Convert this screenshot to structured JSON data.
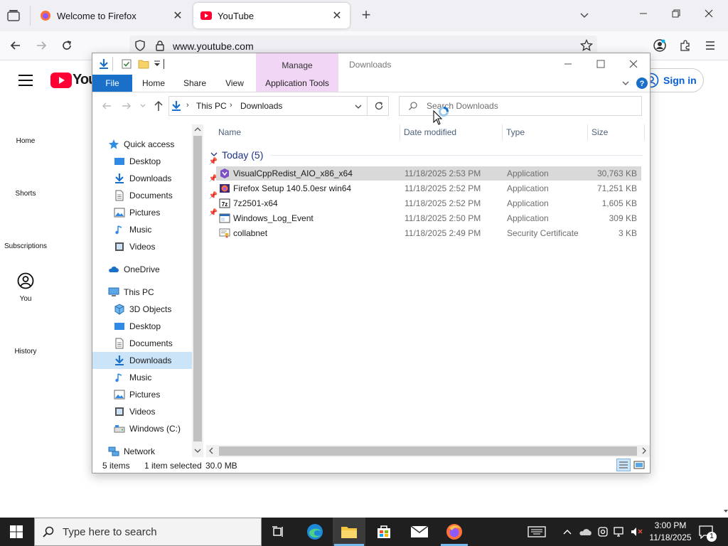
{
  "browser": {
    "tabs": [
      {
        "title": "Welcome to Firefox",
        "active": false
      },
      {
        "title": "YouTube",
        "active": true
      }
    ],
    "url": "www.youtube.com"
  },
  "youtube": {
    "logo_text": "You",
    "sidebar": [
      "Home",
      "Shorts",
      "Subscriptions",
      "You",
      "History"
    ],
    "signin_label": "Sign in"
  },
  "explorer": {
    "title": "Downloads",
    "context_tab": "Manage",
    "ribbon_tabs": [
      "File",
      "Home",
      "Share",
      "View",
      "Application Tools"
    ],
    "breadcrumb": [
      "This PC",
      "Downloads"
    ],
    "search_placeholder": "Search Downloads",
    "columns": [
      "Name",
      "Date modified",
      "Type",
      "Size"
    ],
    "group_label": "Today (5)",
    "files": [
      {
        "name": "VisualCppRedist_AIO_x86_x64",
        "date": "11/18/2025 2:53 PM",
        "type": "Application",
        "size": "30,763 KB",
        "selected": true
      },
      {
        "name": "Firefox Setup 140.5.0esr win64",
        "date": "11/18/2025 2:52 PM",
        "type": "Application",
        "size": "71,251 KB",
        "selected": false
      },
      {
        "name": "7z2501-x64",
        "date": "11/18/2025 2:52 PM",
        "type": "Application",
        "size": "1,605 KB",
        "selected": false
      },
      {
        "name": "Windows_Log_Event",
        "date": "11/18/2025 2:50 PM",
        "type": "Application",
        "size": "309 KB",
        "selected": false
      },
      {
        "name": "collabnet",
        "date": "11/18/2025 2:49 PM",
        "type": "Security Certificate",
        "size": "3 KB",
        "selected": false
      }
    ],
    "nav": {
      "quick_access": "Quick access",
      "quick_items": [
        "Desktop",
        "Downloads",
        "Documents",
        "Pictures",
        "Music",
        "Videos"
      ],
      "onedrive": "OneDrive",
      "this_pc": "This PC",
      "pc_items": [
        "3D Objects",
        "Desktop",
        "Documents",
        "Downloads",
        "Music",
        "Pictures",
        "Videos",
        "Windows (C:)"
      ],
      "network": "Network"
    },
    "status": {
      "items": "5 items",
      "selected": "1 item selected",
      "size": "30.0 MB"
    }
  },
  "taskbar": {
    "search_placeholder": "Type here to search",
    "time": "3:00 PM",
    "date": "11/18/2025",
    "notification_count": "1"
  }
}
